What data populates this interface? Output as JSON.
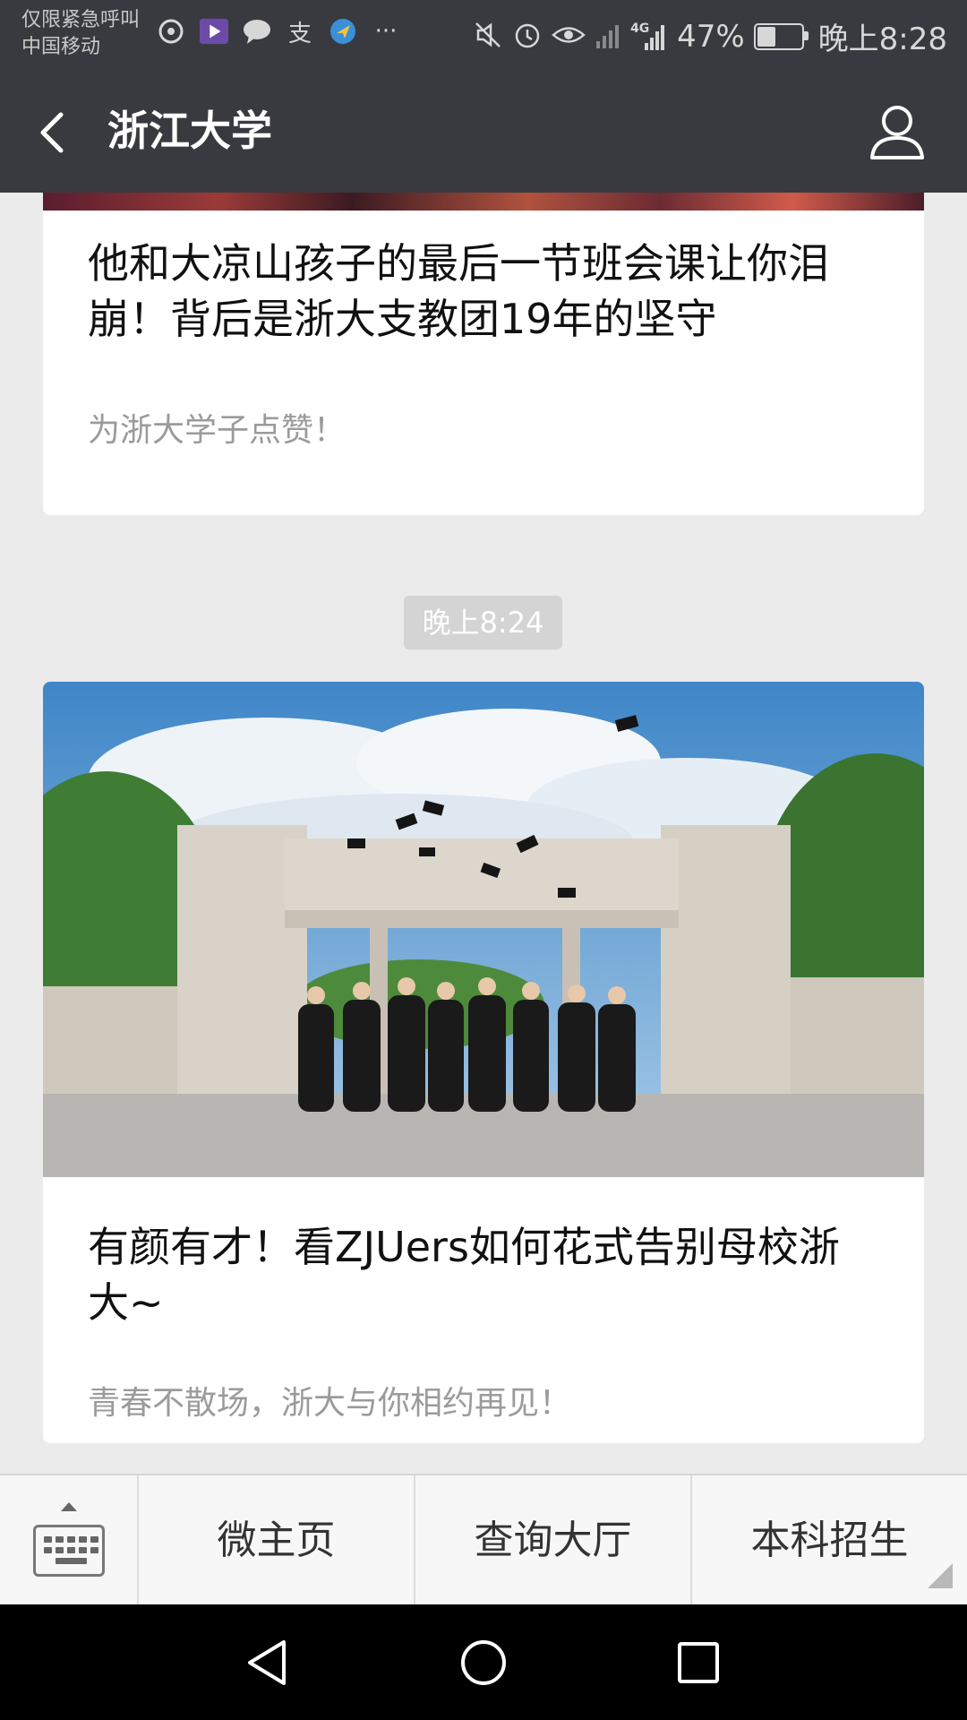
{
  "status_bar": {
    "carrier_line1": "仅限紧急呼叫",
    "carrier_line2": "中国移动",
    "left_icons": [
      "netease-music-icon",
      "video-app-icon",
      "message-bubble-icon",
      "alipay-icon",
      "maps-icon",
      "more-dots-icon"
    ],
    "more": "···",
    "network": "4G",
    "battery_percent": "47%",
    "battery_level": 0.47,
    "time": "晚上8:28"
  },
  "navbar": {
    "title": "浙江大学"
  },
  "articles": [
    {
      "title": "他和大凉山孩子的最后一节班会课让你泪崩！背后是浙大支教团19年的坚守",
      "subtitle": "为浙大学子点赞！"
    },
    {
      "time_badge": "晚上8:24",
      "title": "有颜有才！看ZJUers如何花式告别母校浙大~",
      "subtitle": "青春不散场，浙大与你相约再见！"
    }
  ],
  "menu": {
    "items": [
      "微主页",
      "查询大厅",
      "本科招生"
    ]
  },
  "colors": {
    "header_bg": "#393a3f",
    "page_bg": "#ebebeb",
    "card_bg": "#ffffff",
    "subtitle": "#9b9b9b"
  }
}
